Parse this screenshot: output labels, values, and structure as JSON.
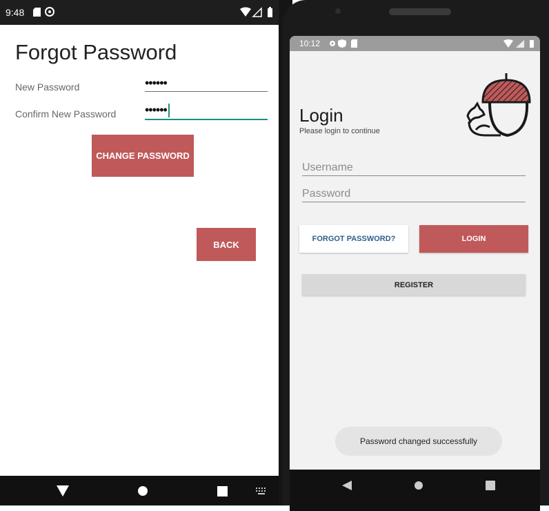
{
  "left": {
    "status": {
      "time": "9:48"
    },
    "title": "Forgot Password",
    "fields": {
      "new_password_label": "New Password",
      "new_password_value": "••••••",
      "confirm_label": "Confirm New Password",
      "confirm_value": "••••••"
    },
    "buttons": {
      "change_password": "CHANGE PASSWORD",
      "back": "BACK"
    },
    "colors": {
      "accent_button": "#c0595a",
      "focus_underline": "#1a8f7e"
    }
  },
  "right": {
    "status": {
      "time": "10:12"
    },
    "login": {
      "title": "Login",
      "subtitle": "Please login to continue",
      "username_placeholder": "Username",
      "password_placeholder": "Password",
      "forgot_button": "FORGOT PASSWORD?",
      "login_button": "LOGIN",
      "register_button": "REGISTER"
    },
    "toast": "Password changed successfully",
    "logo_icon": "squirrel-acorn-logo"
  },
  "icons": {
    "nav_back": "back-triangle-icon",
    "nav_home": "home-circle-icon",
    "nav_recents": "recents-square-icon",
    "keyboard": "keyboard-icon"
  }
}
